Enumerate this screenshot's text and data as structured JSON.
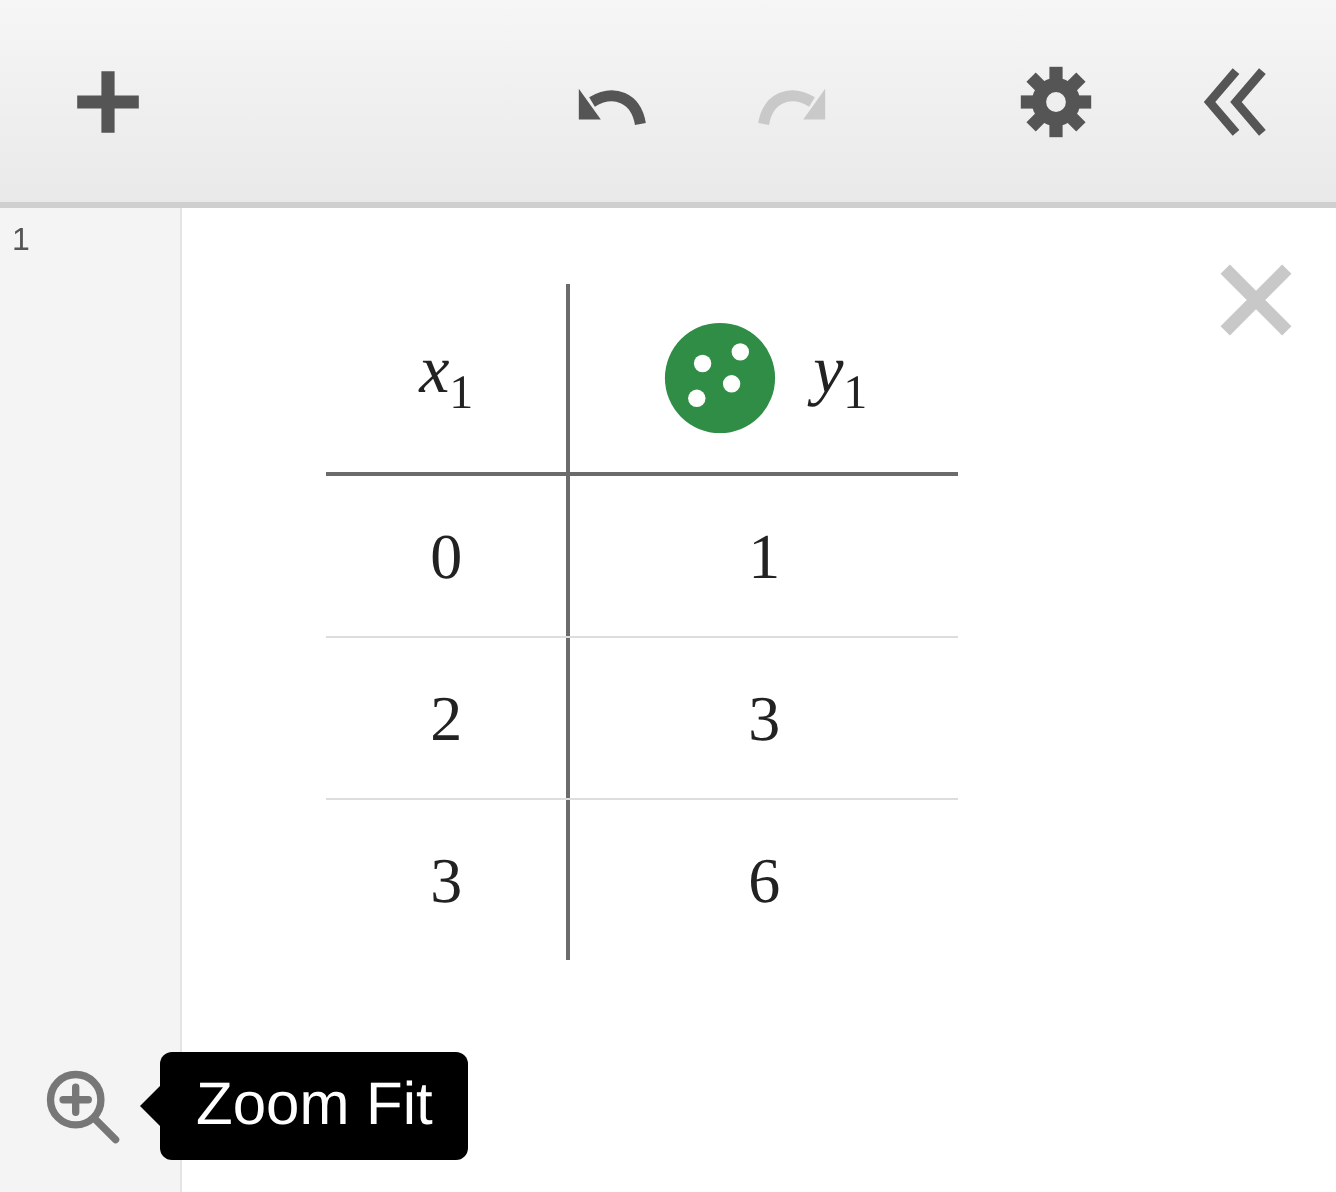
{
  "toolbar": {
    "buttons": [
      {
        "kind": "add",
        "disabled": false
      },
      {
        "kind": "undo",
        "disabled": false
      },
      {
        "kind": "redo",
        "disabled": true
      },
      {
        "kind": "settings",
        "disabled": false
      },
      {
        "kind": "collapse",
        "disabled": false
      }
    ]
  },
  "expression": {
    "index": "1",
    "table": {
      "columns": [
        {
          "header": "*x*$_{1}$"
        },
        {
          "header": "*y*$_{1}$",
          "color": "#2f8d46"
        }
      ],
      "rows": [
        [
          "0",
          "1"
        ],
        [
          "2",
          "3"
        ],
        [
          "3",
          "6"
        ]
      ]
    }
  },
  "tooltip": {
    "text": "Zoom Fit"
  }
}
